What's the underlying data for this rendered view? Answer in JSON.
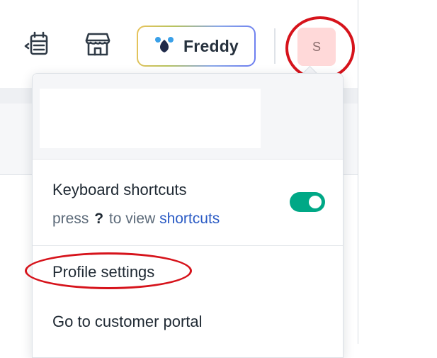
{
  "header": {
    "assistant_label": "Freddy",
    "avatar_initial": "S",
    "icons": [
      "calendar-icon",
      "store-icon",
      "freddy-paw-icon"
    ]
  },
  "menu": {
    "keyboard_shortcuts": {
      "title": "Keyboard shortcuts",
      "sub_prefix": "press",
      "sub_key": "?",
      "sub_middle": "to view",
      "sub_link": "shortcuts",
      "enabled": true
    },
    "items": [
      {
        "label": "Profile settings"
      },
      {
        "label": "Go to customer portal"
      }
    ]
  },
  "colors": {
    "toggle_on": "#00a886",
    "link": "#2c5cc5",
    "avatar_bg": "#ffd9d9",
    "annotation_ring": "#d6131b"
  }
}
